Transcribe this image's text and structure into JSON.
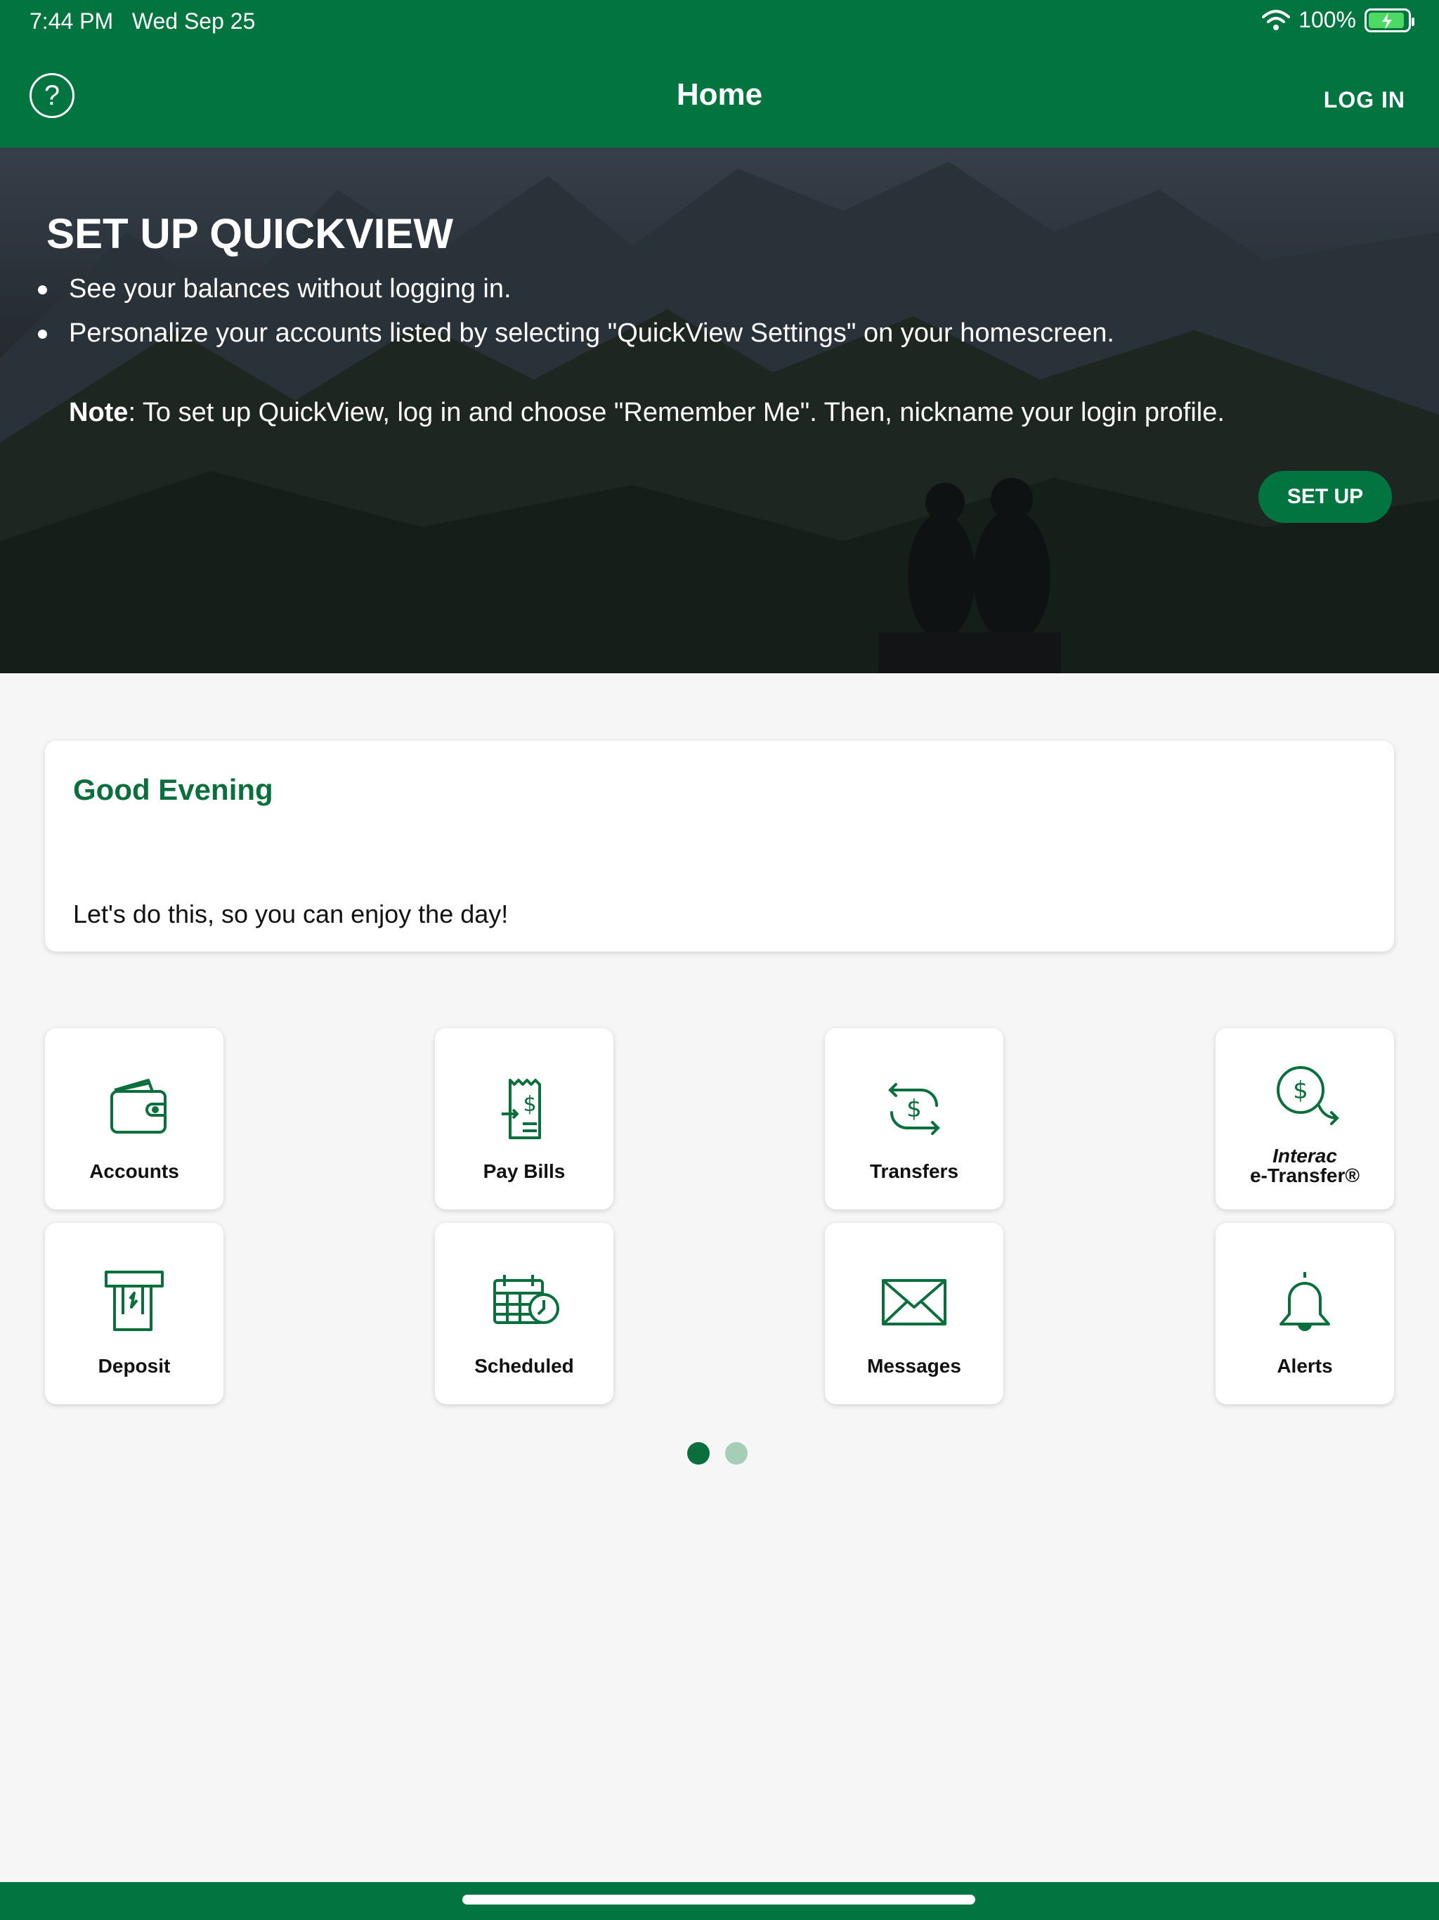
{
  "status": {
    "time": "7:44 PM",
    "date": "Wed Sep 25",
    "battery": "100%"
  },
  "header": {
    "help_icon": "?",
    "title": "Home",
    "login_label": "LOG IN"
  },
  "hero": {
    "title": "SET UP QUICKVIEW",
    "bullets": [
      "See your balances without logging in.",
      "Personalize your accounts listed by selecting \"QuickView Settings\" on your homescreen."
    ],
    "note_label": "Note",
    "note_text": ": To set up QuickView, log in and choose \"Remember Me\". Then, nickname your login profile.",
    "button_label": "SET UP"
  },
  "greeting": {
    "title": "Good Evening",
    "message": "Let's do this, so you can enjoy the day!"
  },
  "tiles": [
    {
      "label": "Accounts",
      "icon": "wallet-icon"
    },
    {
      "label": "Pay Bills",
      "icon": "bill-icon"
    },
    {
      "label": "Transfers",
      "icon": "transfer-icon"
    },
    {
      "label_line1": "Interac",
      "label_line2": "e-Transfer®",
      "icon": "etransfer-icon"
    },
    {
      "label": "Deposit",
      "icon": "deposit-icon"
    },
    {
      "label": "Scheduled",
      "icon": "calendar-clock-icon"
    },
    {
      "label": "Messages",
      "icon": "envelope-icon"
    },
    {
      "label": "Alerts",
      "icon": "bell-icon"
    }
  ],
  "pager": {
    "pages": 2,
    "current": 1
  },
  "colors": {
    "brand": "#017440",
    "accent_text": "#0b6e3d",
    "dot_inactive": "#a6cdb8"
  }
}
